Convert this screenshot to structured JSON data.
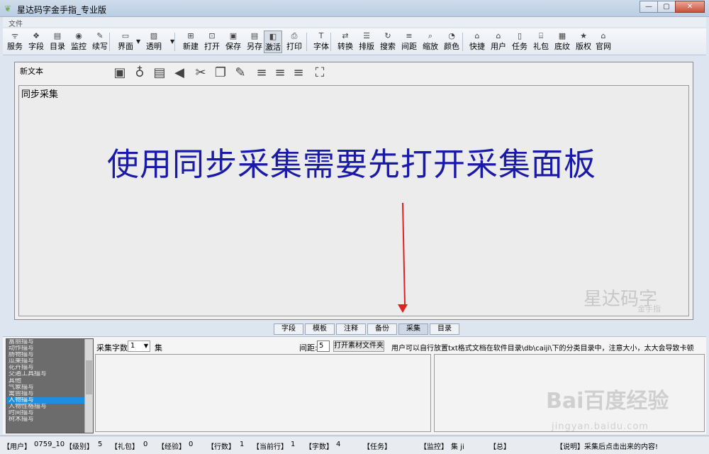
{
  "window": {
    "title": "星达码字金手指_专业版",
    "controls": [
      "—",
      "▢",
      "✕"
    ]
  },
  "menu": {
    "file": "文件"
  },
  "toolbar": {
    "items": [
      {
        "label": "服务",
        "icon": "rss-icon",
        "glyph": "ᯤ"
      },
      {
        "label": "字段",
        "icon": "diamond-icon",
        "glyph": "❖"
      },
      {
        "label": "目录",
        "icon": "list-icon",
        "glyph": "▤"
      },
      {
        "label": "监控",
        "icon": "eye-icon",
        "glyph": "◉"
      },
      {
        "label": "续写",
        "icon": "pen-icon",
        "glyph": "✎"
      },
      {
        "label": "界面",
        "icon": "window-icon",
        "glyph": "▭"
      },
      {
        "label": "透明",
        "icon": "picture-icon",
        "glyph": "▨"
      },
      {
        "label": "新建",
        "icon": "new-icon",
        "glyph": "⊞"
      },
      {
        "label": "打开",
        "icon": "open-icon",
        "glyph": "⊡"
      },
      {
        "label": "保存",
        "icon": "save-icon",
        "glyph": "▣"
      },
      {
        "label": "另存",
        "icon": "save-as-icon",
        "glyph": "▤"
      },
      {
        "label": "激活",
        "icon": "activate-icon",
        "glyph": "◧"
      },
      {
        "label": "打印",
        "icon": "print-icon",
        "glyph": "⎙"
      },
      {
        "label": "字体",
        "icon": "font-icon",
        "glyph": "T"
      },
      {
        "label": "转换",
        "icon": "convert-icon",
        "glyph": "⇄"
      },
      {
        "label": "排版",
        "icon": "layout-icon",
        "glyph": "☰"
      },
      {
        "label": "搜索",
        "icon": "refresh-icon",
        "glyph": "↻"
      },
      {
        "label": "间距",
        "icon": "spacing-icon",
        "glyph": "≡"
      },
      {
        "label": "缩放",
        "icon": "zoom-icon",
        "glyph": "⌕"
      },
      {
        "label": "颜色",
        "icon": "color-icon",
        "glyph": "◔"
      },
      {
        "label": "快捷",
        "icon": "shortcut-icon",
        "glyph": "⌂"
      },
      {
        "label": "用户",
        "icon": "user-icon",
        "glyph": "⌂"
      },
      {
        "label": "任务",
        "icon": "task-icon",
        "glyph": "▯"
      },
      {
        "label": "礼包",
        "icon": "gift-icon",
        "glyph": "⌸"
      },
      {
        "label": "底纹",
        "icon": "texture-icon",
        "glyph": "▦"
      },
      {
        "label": "版权",
        "icon": "star-icon",
        "glyph": "★"
      },
      {
        "label": "官网",
        "icon": "home-icon",
        "glyph": "⌂"
      }
    ]
  },
  "editor": {
    "doc_name": "新文本",
    "content": "同步采集",
    "message": "使用同步采集需要先打开采集面板",
    "watermark": "星达码字",
    "watermark_sub": "金手指",
    "format_icons": [
      "save-icon",
      "bulb-icon",
      "document-icon",
      "back-icon",
      "scissors-icon",
      "copy-icon",
      "edit-icon",
      "align-left-icon",
      "align-center-icon",
      "align-right-icon",
      "fullscreen-icon"
    ]
  },
  "tabs": [
    {
      "label": "字段"
    },
    {
      "label": "模板"
    },
    {
      "label": "注释"
    },
    {
      "label": "备份"
    },
    {
      "label": "采集",
      "active": true
    },
    {
      "label": "目录"
    }
  ],
  "collect": {
    "categories": [
      "富丽描写",
      "动作描写",
      "肠物描写",
      "瓜果描写",
      "花卉描写",
      "交通工具描写",
      "其他",
      "气象描写",
      "禽兽描写",
      "人物描写",
      "人物性格描写",
      "时间描写",
      "树木描写"
    ],
    "selected_category": "人物描写",
    "count_label": "采集字数",
    "count_value": "1",
    "count_unit": "集",
    "spacing_label": "间距:",
    "spacing_value": "5",
    "open_folder": "打开素材文件夹",
    "hint": "用户可以自行放置txt格式文档在软件目录\\db\\caiji\\下的分类目录中，注意大小，太大会导致卡顿"
  },
  "baidu": {
    "logo": "Bai百度经验",
    "url": "jingyan.baidu.com"
  },
  "status": {
    "user_label": "【用户】",
    "user": "0759_10",
    "level_label": "【级别】",
    "level": "5",
    "gift_label": "【礼包】",
    "gift": "0",
    "exp_label": "【经验】",
    "exp": "0",
    "lines_label": "【行数】",
    "lines": "1",
    "current_label": "【当前行】",
    "current": "1",
    "chars_label": "【字数】",
    "chars": "4",
    "task_label": "【任务】",
    "monitor_label": "【监控】",
    "monitor": "集 ji",
    "total_label": "【总】",
    "note_label": "【说明】",
    "note": "采集后点击出来的内容!"
  }
}
